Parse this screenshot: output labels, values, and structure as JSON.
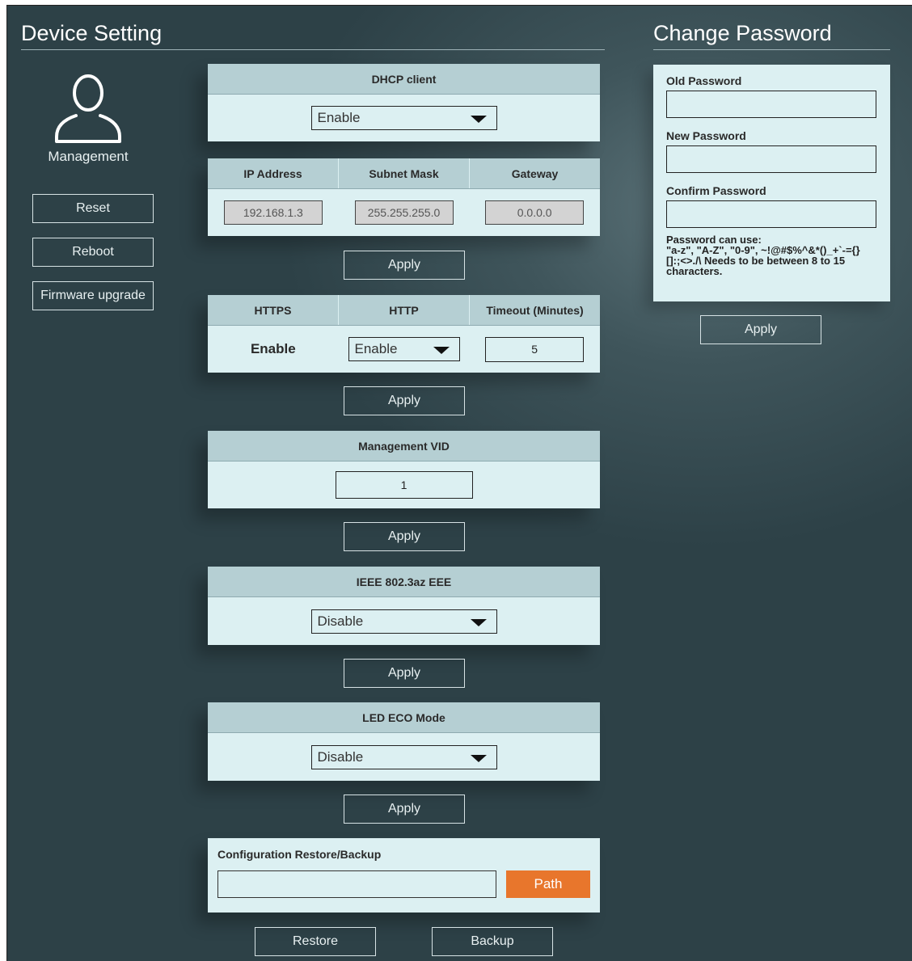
{
  "device_setting": {
    "title": "Device Setting",
    "management_label": "Management",
    "buttons": {
      "reset": "Reset",
      "reboot": "Reboot",
      "firmware": "Firmware upgrade"
    }
  },
  "dhcp": {
    "header": "DHCP client",
    "value": "Enable"
  },
  "network": {
    "headers": [
      "IP Address",
      "Subnet Mask",
      "Gateway"
    ],
    "ip": "192.168.1.3",
    "mask": "255.255.255.0",
    "gateway": "0.0.0.0",
    "apply": "Apply"
  },
  "web": {
    "headers": [
      "HTTPS",
      "HTTP",
      "Timeout (Minutes)"
    ],
    "https_value": "Enable",
    "http_value": "Enable",
    "timeout_value": "5",
    "apply": "Apply"
  },
  "vid": {
    "header": "Management VID",
    "value": "1",
    "apply": "Apply"
  },
  "eee": {
    "header": "IEEE 802.3az EEE",
    "value": "Disable",
    "apply": "Apply"
  },
  "led": {
    "header": "LED ECO Mode",
    "value": "Disable",
    "apply": "Apply"
  },
  "config": {
    "label": "Configuration Restore/Backup",
    "path_button": "Path",
    "restore": "Restore",
    "backup": "Backup"
  },
  "password": {
    "title": "Change Password",
    "old_label": "Old Password",
    "new_label": "New Password",
    "confirm_label": "Confirm Password",
    "note_line1": "Password can use:",
    "note_line2": "\"a-z\", \"A-Z\", \"0-9\", ~!@#$%^&*()_+`-={}",
    "note_line3": "[]:;<>./\\ Needs to be between 8 to 15",
    "note_line4": "characters.",
    "apply": "Apply"
  },
  "colors": {
    "accent_orange": "#e8762c",
    "panel_bg": "#dcf0f2",
    "panel_header": "#b5cfd3",
    "screen_bg": "#34494f"
  }
}
